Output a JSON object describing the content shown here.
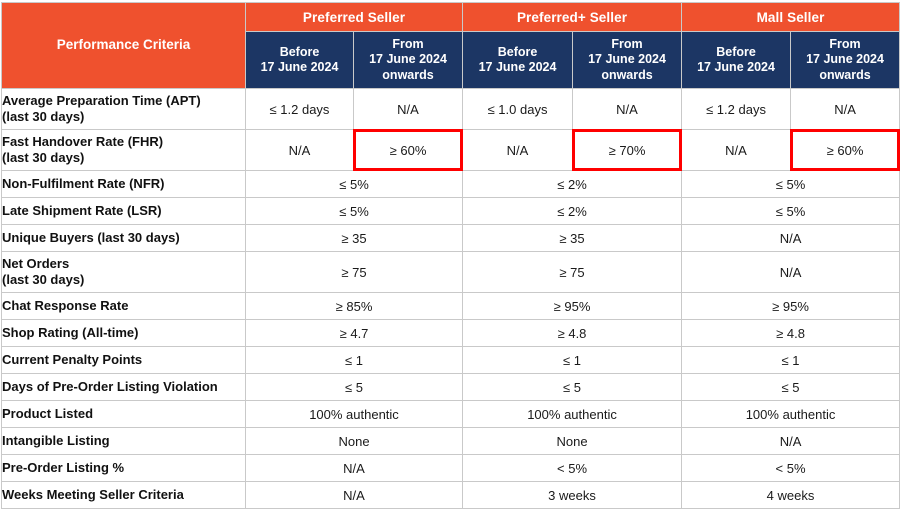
{
  "table": {
    "criteria_header": "Performance Criteria",
    "groups": [
      {
        "label": "Preferred Seller"
      },
      {
        "label": "Preferred+ Seller"
      },
      {
        "label": "Mall Seller"
      }
    ],
    "subheaders": {
      "before_line1": "Before",
      "before_line2": "17 June 2024",
      "from_line1": "From",
      "from_line2": "17 June 2024",
      "from_line3": "onwards"
    },
    "rows": [
      {
        "criteria_line1": "Average Preparation Time (APT)",
        "criteria_line2": "(last 30 days)",
        "split": true,
        "tall": true,
        "values": [
          "≤ 1.2 days",
          "N/A",
          "≤ 1.0 days",
          "N/A",
          "≤ 1.2 days",
          "N/A"
        ],
        "highlight": [
          false,
          false,
          false,
          false,
          false,
          false
        ]
      },
      {
        "criteria_line1": "Fast Handover Rate (FHR)",
        "criteria_line2": "(last 30 days)",
        "split": true,
        "tall": true,
        "values": [
          "N/A",
          "≥ 60%",
          "N/A",
          "≥ 70%",
          "N/A",
          "≥ 60%"
        ],
        "highlight": [
          false,
          true,
          false,
          true,
          false,
          true
        ]
      },
      {
        "criteria_line1": "Non-Fulfilment Rate (NFR)",
        "criteria_line2": "",
        "split": false,
        "tall": false,
        "values": [
          "≤ 5%",
          "≤ 2%",
          "≤ 5%"
        ],
        "highlight": [
          false,
          false,
          false
        ]
      },
      {
        "criteria_line1": "Late Shipment Rate (LSR)",
        "criteria_line2": "",
        "split": false,
        "tall": false,
        "values": [
          "≤ 5%",
          "≤ 2%",
          "≤ 5%"
        ],
        "highlight": [
          false,
          false,
          false
        ]
      },
      {
        "criteria_line1": "Unique Buyers (last 30 days)",
        "criteria_line2": "",
        "split": false,
        "tall": false,
        "values": [
          "≥ 35",
          "≥ 35",
          "N/A"
        ],
        "highlight": [
          false,
          false,
          false
        ]
      },
      {
        "criteria_line1": "Net Orders",
        "criteria_line2": "(last 30 days)",
        "split": false,
        "tall": true,
        "values": [
          "≥ 75",
          "≥ 75",
          "N/A"
        ],
        "highlight": [
          false,
          false,
          false
        ]
      },
      {
        "criteria_line1": "Chat Response Rate",
        "criteria_line2": "",
        "split": false,
        "tall": false,
        "values": [
          "≥ 85%",
          "≥ 95%",
          "≥ 95%"
        ],
        "highlight": [
          false,
          false,
          false
        ]
      },
      {
        "criteria_line1": "Shop Rating (All-time)",
        "criteria_line2": "",
        "split": false,
        "tall": false,
        "values": [
          "≥ 4.7",
          "≥ 4.8",
          "≥ 4.8"
        ],
        "highlight": [
          false,
          false,
          false
        ]
      },
      {
        "criteria_line1": "Current Penalty Points",
        "criteria_line2": "",
        "split": false,
        "tall": false,
        "values": [
          "≤ 1",
          "≤ 1",
          "≤ 1"
        ],
        "highlight": [
          false,
          false,
          false
        ]
      },
      {
        "criteria_line1": "Days of Pre-Order Listing Violation",
        "criteria_line2": "",
        "split": false,
        "tall": false,
        "values": [
          "≤ 5",
          "≤ 5",
          "≤ 5"
        ],
        "highlight": [
          false,
          false,
          false
        ]
      },
      {
        "criteria_line1": "Product Listed",
        "criteria_line2": "",
        "split": false,
        "tall": false,
        "values": [
          "100% authentic",
          "100% authentic",
          "100% authentic"
        ],
        "highlight": [
          false,
          false,
          false
        ]
      },
      {
        "criteria_line1": "Intangible Listing",
        "criteria_line2": "",
        "split": false,
        "tall": false,
        "values": [
          "None",
          "None",
          "N/A"
        ],
        "highlight": [
          false,
          false,
          false
        ]
      },
      {
        "criteria_line1": "Pre-Order Listing %",
        "criteria_line2": "",
        "split": false,
        "tall": false,
        "values": [
          "N/A",
          "< 5%",
          "< 5%"
        ],
        "highlight": [
          false,
          false,
          false
        ]
      },
      {
        "criteria_line1": "Weeks Meeting Seller Criteria",
        "criteria_line2": "",
        "split": false,
        "tall": false,
        "values": [
          "N/A",
          "3 weeks",
          "4 weeks"
        ],
        "highlight": [
          false,
          false,
          false
        ]
      }
    ]
  },
  "colors": {
    "header_orange": "#EF512E",
    "header_navy": "#1C3664",
    "highlight_red": "#FF0000",
    "grid_line": "#C9C9C9"
  }
}
